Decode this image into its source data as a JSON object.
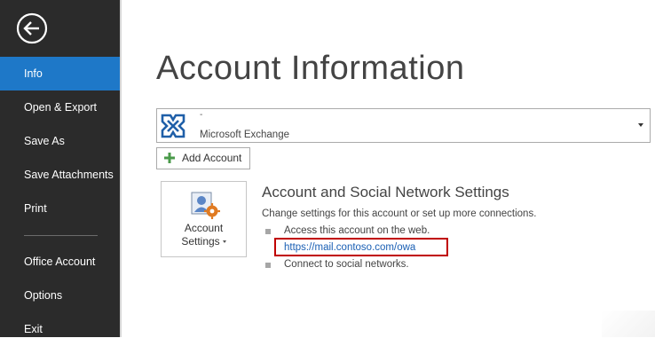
{
  "sidebar": {
    "back_label": "Back",
    "items": [
      {
        "label": "Info",
        "active": true
      },
      {
        "label": "Open & Export"
      },
      {
        "label": "Save As"
      },
      {
        "label": "Save Attachments"
      },
      {
        "label": "Print"
      },
      {
        "label": "Office Account"
      },
      {
        "label": "Options"
      },
      {
        "label": "Exit"
      }
    ]
  },
  "main": {
    "title": "Account Information",
    "account_selector": {
      "name": "-",
      "type": "Microsoft Exchange",
      "icon": "exchange-icon"
    },
    "add_account_label": "Add Account",
    "account_settings": {
      "line1": "Account",
      "line2": "Settings"
    },
    "section": {
      "heading": "Account and Social Network Settings",
      "description": "Change settings for this account or set up more connections.",
      "bullets": [
        "Access this account on the web.",
        "Connect to social networks."
      ],
      "owa_link": "https://mail.contoso.com/owa"
    }
  },
  "colors": {
    "sidebar_bg": "#2b2b2b",
    "active_item": "#1e78c8",
    "highlight_box": "#c00000",
    "link": "#1a5fb4",
    "exchange_blue": "#1f5fa8"
  }
}
